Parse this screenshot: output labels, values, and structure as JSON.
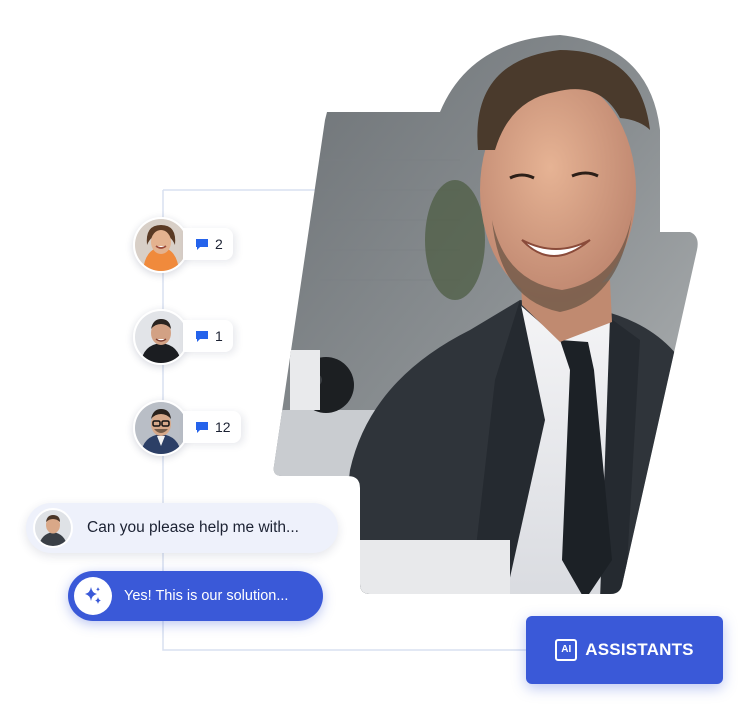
{
  "threads": [
    {
      "name": "woman-avatar",
      "count": "2"
    },
    {
      "name": "man-avatar-1",
      "count": "1"
    },
    {
      "name": "man-avatar-2",
      "count": "12"
    }
  ],
  "chat": {
    "user_message": "Can you please help me with...",
    "ai_reply": "Yes! This is our solution..."
  },
  "assistants_button": {
    "badge": "AI",
    "label": "ASSISTANTS"
  },
  "colors": {
    "accent": "#3a59d8",
    "bubble_user_bg": "#eef1fb",
    "connector": "#d8e0f0",
    "comment_icon": "#2563eb"
  }
}
